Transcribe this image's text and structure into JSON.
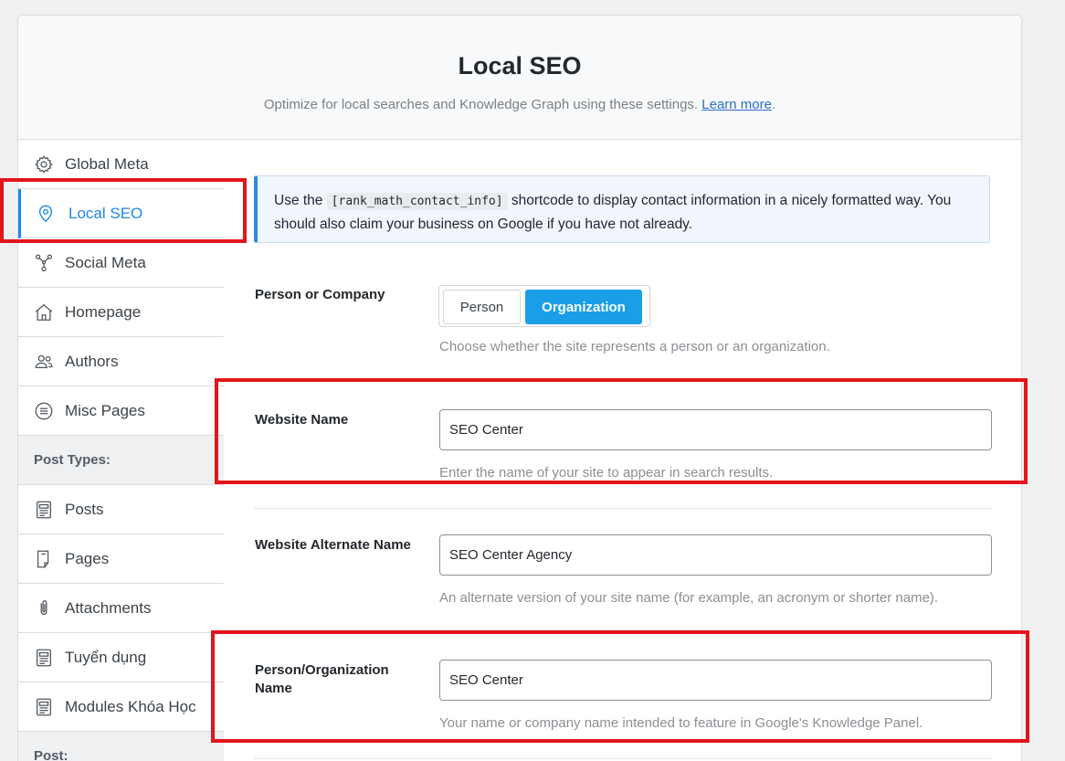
{
  "header": {
    "title": "Local SEO",
    "subtitle": "Optimize for local searches and Knowledge Graph using these settings.",
    "learn_more": "Learn more",
    "period": "."
  },
  "sidebar": {
    "items": [
      {
        "label": "Global Meta",
        "icon": "gear-icon"
      },
      {
        "label": "Local SEO",
        "icon": "location-pin-icon",
        "active": true
      },
      {
        "label": "Social Meta",
        "icon": "share-icon"
      },
      {
        "label": "Homepage",
        "icon": "home-icon"
      },
      {
        "label": "Authors",
        "icon": "users-icon"
      },
      {
        "label": "Misc Pages",
        "icon": "list-circle-icon"
      }
    ],
    "section_post_types": "Post Types:",
    "post_types": [
      {
        "label": "Posts",
        "icon": "document-icon"
      },
      {
        "label": "Pages",
        "icon": "page-icon"
      },
      {
        "label": "Attachments",
        "icon": "paperclip-icon"
      },
      {
        "label": "Tuyển dụng",
        "icon": "document-icon"
      },
      {
        "label": "Modules Khóa Học",
        "icon": "document-icon"
      }
    ],
    "section_post": "Post:"
  },
  "notice": {
    "before": "Use the ",
    "shortcode": "[rank_math_contact_info]",
    "after": " shortcode to display contact information in a nicely formatted way. You should also claim your business on Google if you have not already."
  },
  "fields": {
    "person_or_company": {
      "label": "Person or Company",
      "options": [
        "Person",
        "Organization"
      ],
      "selected": "Organization",
      "description": "Choose whether the site represents a person or an organization."
    },
    "website_name": {
      "label": "Website Name",
      "value": "SEO Center",
      "description": "Enter the name of your site to appear in search results."
    },
    "website_alternate_name": {
      "label": "Website Alternate Name",
      "value": "SEO Center Agency",
      "description": "An alternate version of your site name (for example, an acronym or shorter name)."
    },
    "person_org_name": {
      "label": "Person/Organization Name",
      "value": "SEO Center",
      "description": "Your name or company name intended to feature in Google's Knowledge Panel."
    }
  },
  "colors": {
    "accent": "#1a9ee8",
    "active_nav": "#1e88e5",
    "highlight_red": "#e3141b"
  }
}
